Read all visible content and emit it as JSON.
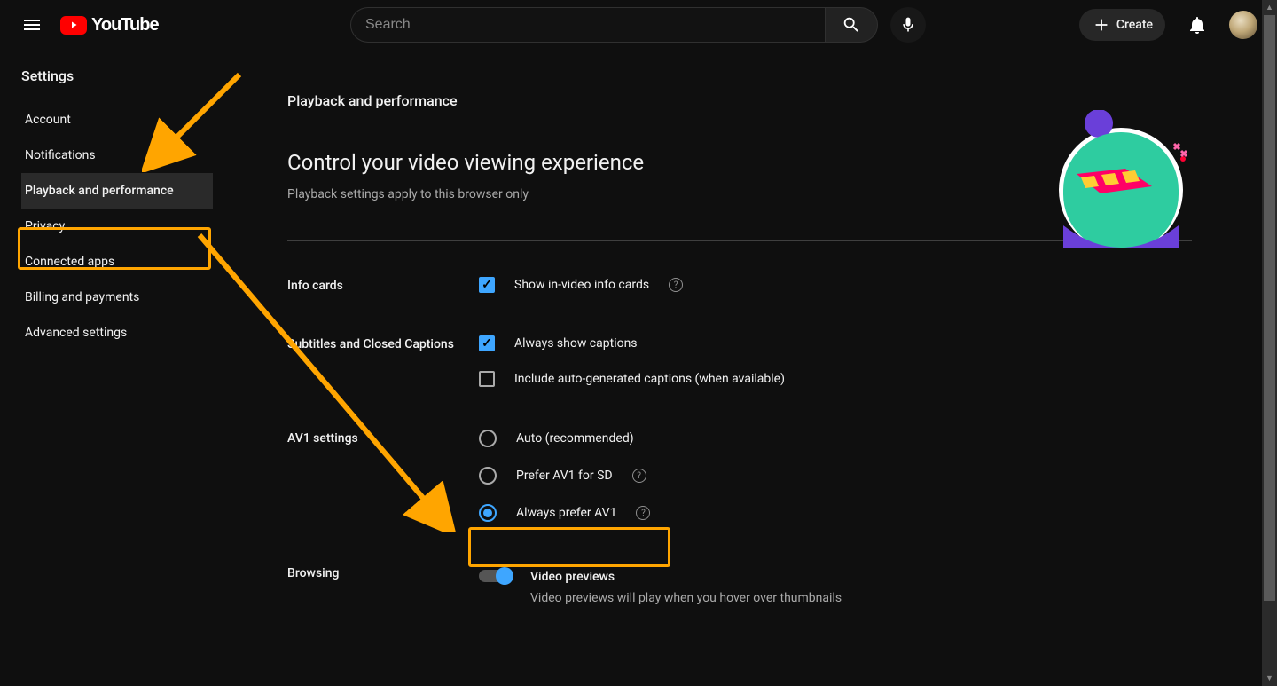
{
  "brand": "YouTube",
  "search": {
    "placeholder": "Search"
  },
  "create_label": "Create",
  "sidebar": {
    "title": "Settings",
    "items": [
      {
        "label": "Account"
      },
      {
        "label": "Notifications"
      },
      {
        "label": "Playback and performance"
      },
      {
        "label": "Privacy"
      },
      {
        "label": "Connected apps"
      },
      {
        "label": "Billing and payments"
      },
      {
        "label": "Advanced settings"
      }
    ]
  },
  "page": {
    "heading": "Playback and performance",
    "control_title": "Control your video viewing experience",
    "control_sub": "Playback settings apply to this browser only",
    "info_cards_label": "Info cards",
    "info_cards_option": "Show in-video info cards",
    "captions_label": "Subtitles and Closed Captions",
    "captions_opt1": "Always show captions",
    "captions_opt2": "Include auto-generated captions (when available)",
    "av1_label": "AV1 settings",
    "av1_opt1": "Auto (recommended)",
    "av1_opt2": "Prefer AV1 for SD",
    "av1_opt3": "Always prefer AV1",
    "browsing_label": "Browsing",
    "preview_title": "Video previews",
    "preview_desc": "Video previews will play when you hover over thumbnails"
  }
}
